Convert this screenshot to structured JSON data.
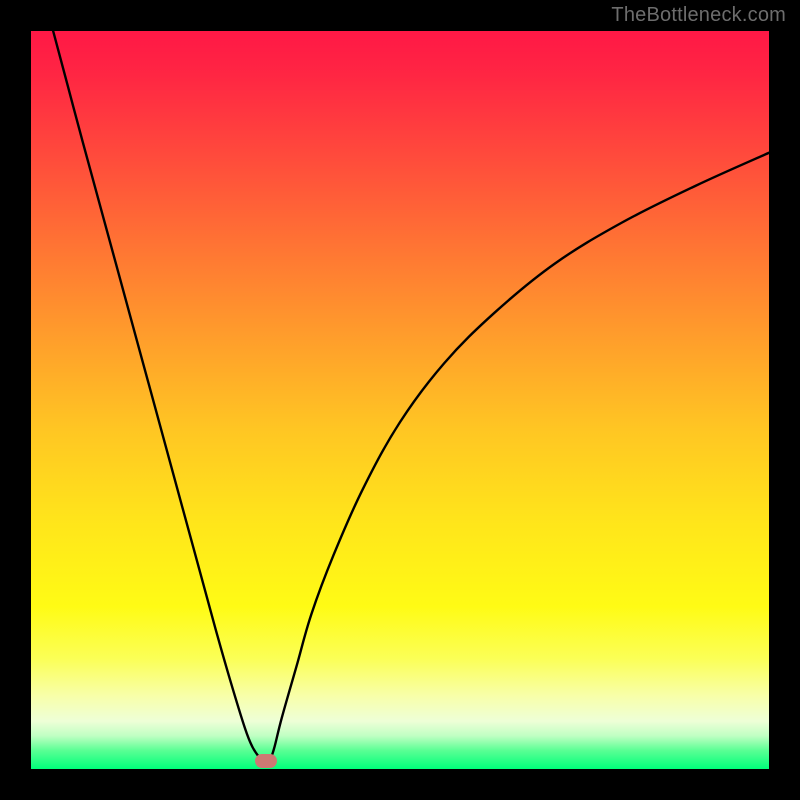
{
  "watermark": "TheBottleneck.com",
  "chart_data": {
    "type": "line",
    "title": "",
    "xlabel": "",
    "ylabel": "",
    "xlim": [
      0,
      100
    ],
    "ylim": [
      0,
      100
    ],
    "grid": false,
    "legend": false,
    "series": [
      {
        "name": "bottleneck-curve",
        "x": [
          3,
          5,
          7,
          10,
          13,
          16,
          19,
          22,
          25,
          27,
          29,
          30,
          31,
          31.5,
          32,
          32.5,
          33,
          34,
          36,
          38,
          41,
          45,
          50,
          56,
          63,
          71,
          80,
          90,
          100
        ],
        "values": [
          100,
          92.5,
          85,
          74,
          63,
          52,
          41,
          30,
          19,
          12,
          5.5,
          3,
          1.5,
          1.1,
          1.1,
          1.5,
          3,
          7,
          14,
          21,
          29,
          38,
          47,
          55,
          62,
          68.5,
          74,
          79,
          83.5
        ]
      }
    ],
    "marker": {
      "x": 31.8,
      "y": 1.1
    },
    "colors": {
      "curve": "#000000",
      "marker": "#cd7973",
      "gradient_top": "#ff1846",
      "gradient_bottom": "#00ff7a"
    }
  }
}
